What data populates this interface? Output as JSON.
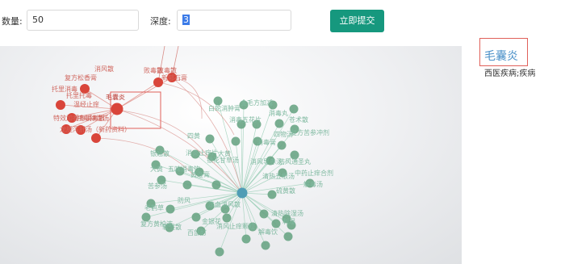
{
  "toolbar": {
    "count_label": "数量:",
    "count_value": "50",
    "depth_label": "深度:",
    "depth_value": "3",
    "submit_label": "立即提交"
  },
  "selected": {
    "name": "毛囊炎",
    "category": "西医疾病;疾病"
  },
  "graph": {
    "red_nodes": [
      "毛囊炎",
      "消风散",
      "败毒散",
      "托里消毒散",
      "复方蛇床",
      "健身汤",
      "温经止痒",
      "托里解毒散",
      "龙胆泻肝汤"
    ],
    "red_labels": [
      "消风散",
      "复方松香膏",
      "败毒散",
      "托里消毒",
      "温经止痒",
      "毛囊炎",
      "祛毒除湿汤",
      "特效加香枣消毒散",
      "龙胆泻肝汤（新药资料）",
      "败毒散",
      "新郁石膏",
      "托里托毒"
    ],
    "green_labels": [
      "白蛇消肿膏",
      "金毛方加减",
      "消毒丸",
      "苍术散",
      "消毒五花片",
      "消毒膏",
      "四物汤",
      "复方苦参冲剂",
      "四黄",
      "大黄",
      "消风导赤汤",
      "防风通圣丸",
      "中药止痒合剂",
      "银翘散",
      "消炎止痒片",
      "银花甘草汤",
      "清热五根汤",
      "硫黄散",
      "大黄",
      "五味消毒饮",
      "黄连膏",
      "解毒汤",
      "苦参汤",
      "防风",
      "凉血消风散",
      "清热除湿汤",
      "老鹤草",
      "软坚散",
      "金银花",
      "消风止痒颗粒",
      "解毒饮",
      "利湿",
      "复方黄柏液",
      "百部酊"
    ]
  },
  "colors": {
    "accent": "#16987e",
    "red_node": "#d9453a",
    "green_node": "#6aa585",
    "hub": "#4f9db5",
    "highlight_border": "#e0605a",
    "link": "#4a90c8"
  }
}
